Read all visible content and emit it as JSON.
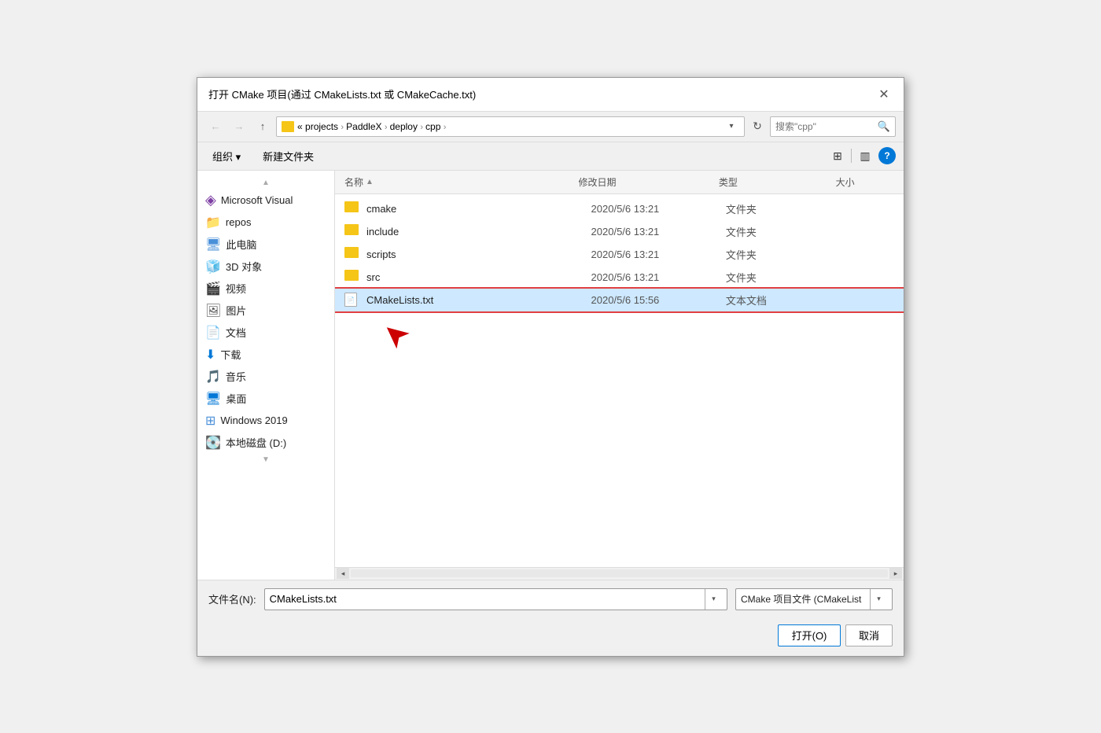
{
  "title": "打开 CMake 项目(通过 CMakeLists.txt 或 CMakeCache.txt)",
  "close_btn": "✕",
  "nav": {
    "back_label": "←",
    "forward_label": "→",
    "up_label": "↑",
    "address_parts": [
      "«",
      "projects",
      "PaddleX",
      "deploy",
      "cpp"
    ],
    "refresh_label": "↻"
  },
  "search_placeholder": "搜索\"cpp\"",
  "toolbar2": {
    "organize_label": "组织 ▾",
    "new_folder_label": "新建文件夹"
  },
  "columns": {
    "name": "名称",
    "date": "修改日期",
    "type": "类型",
    "size": "大小"
  },
  "files": [
    {
      "name": "cmake",
      "date": "2020/5/6 13:21",
      "type": "文件夹",
      "size": ""
    },
    {
      "name": "include",
      "date": "2020/5/6 13:21",
      "type": "文件夹",
      "size": ""
    },
    {
      "name": "scripts",
      "date": "2020/5/6 13:21",
      "type": "文件夹",
      "size": ""
    },
    {
      "name": "src",
      "date": "2020/5/6 13:21",
      "type": "文件夹",
      "size": ""
    },
    {
      "name": "CMakeLists.txt",
      "date": "2020/5/6 15:56",
      "type": "文本文档",
      "size": ""
    }
  ],
  "sidebar": {
    "items": [
      {
        "label": "Microsoft Visual",
        "icon": "vs"
      },
      {
        "label": "repos",
        "icon": "folder"
      },
      {
        "label": "此电脑",
        "icon": "monitor"
      },
      {
        "label": "3D 对象",
        "icon": "cube3d"
      },
      {
        "label": "视频",
        "icon": "video"
      },
      {
        "label": "图片",
        "icon": "image"
      },
      {
        "label": "文档",
        "icon": "doc"
      },
      {
        "label": "下载",
        "icon": "download"
      },
      {
        "label": "音乐",
        "icon": "music"
      },
      {
        "label": "桌面",
        "icon": "desktop"
      },
      {
        "label": "Windows 2019",
        "icon": "windows"
      },
      {
        "label": "本地磁盘 (D:)",
        "icon": "disk"
      }
    ]
  },
  "bottom": {
    "filename_label": "文件名(N):",
    "filename_value": "CMakeLists.txt",
    "filetype_value": "CMake 项目文件 (CMakeList",
    "open_label": "打开(O)",
    "cancel_label": "取消"
  }
}
